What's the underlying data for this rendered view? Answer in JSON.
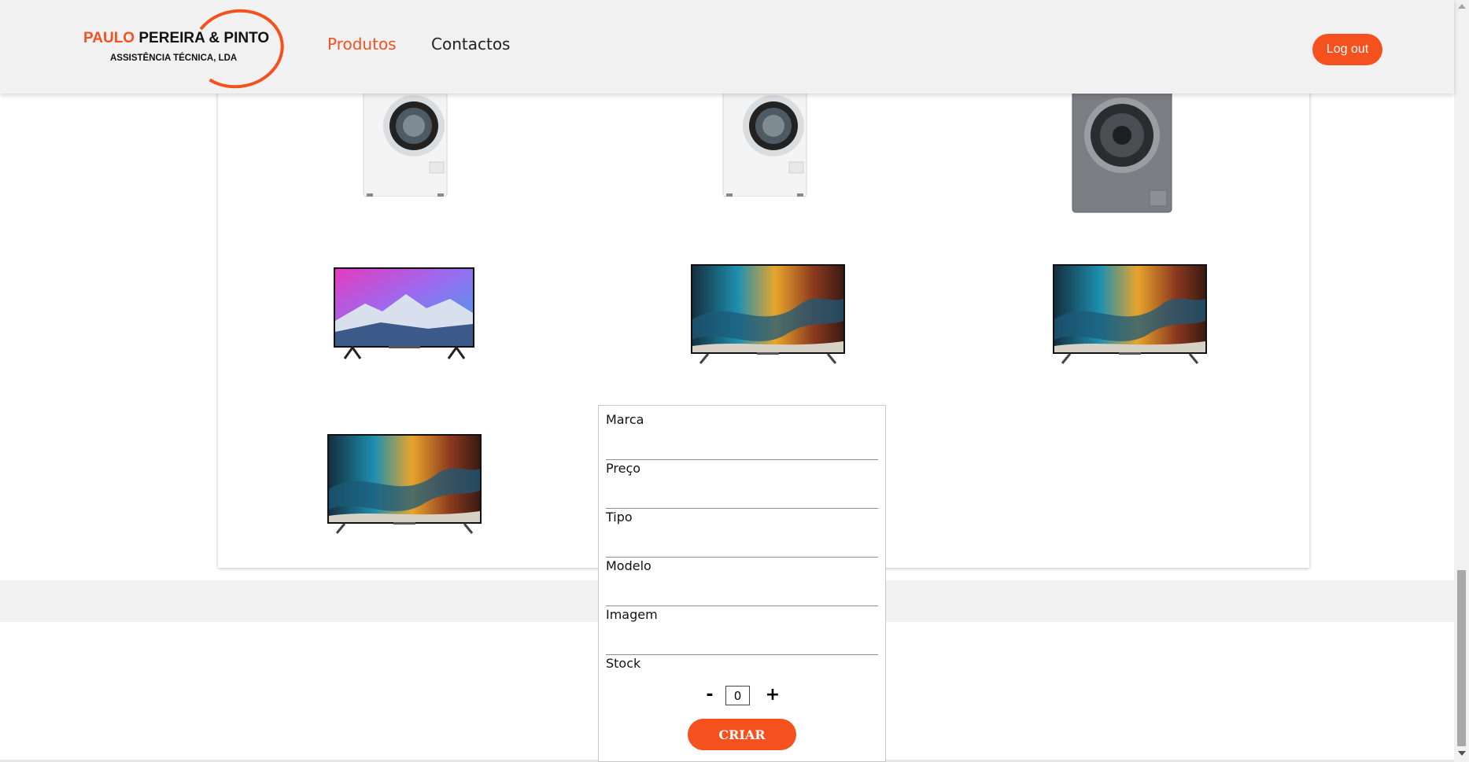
{
  "header": {
    "logo": {
      "line1_accent": "PAULO",
      "line1_rest": " PEREIRA & PINTO",
      "line2": "ASSISTÊNCIA TÉCNICA, LDA"
    },
    "nav": [
      {
        "label": "Produtos",
        "active": true
      },
      {
        "label": "Contactos",
        "active": false
      }
    ],
    "logout_label": "Log out"
  },
  "products": [
    {
      "image": "washing-machine-white"
    },
    {
      "image": "washing-machine-white"
    },
    {
      "image": "washing-machine-silver"
    },
    {
      "image": "tv-mountain-landscape"
    },
    {
      "image": "tv-abstract-wave"
    },
    {
      "image": "tv-abstract-wave"
    },
    {
      "image": "tv-abstract-wave"
    }
  ],
  "form": {
    "fields": [
      {
        "label": "Marca",
        "value": ""
      },
      {
        "label": "Preço",
        "value": ""
      },
      {
        "label": "Tipo",
        "value": ""
      },
      {
        "label": "Modelo",
        "value": ""
      },
      {
        "label": "Imagem",
        "value": ""
      }
    ],
    "stock": {
      "label": "Stock",
      "minus": "-",
      "plus": "+",
      "value": "0"
    },
    "submit_label": "CRIAR"
  },
  "colors": {
    "accent": "#f4511e",
    "header_bg": "#f1f1f1"
  }
}
